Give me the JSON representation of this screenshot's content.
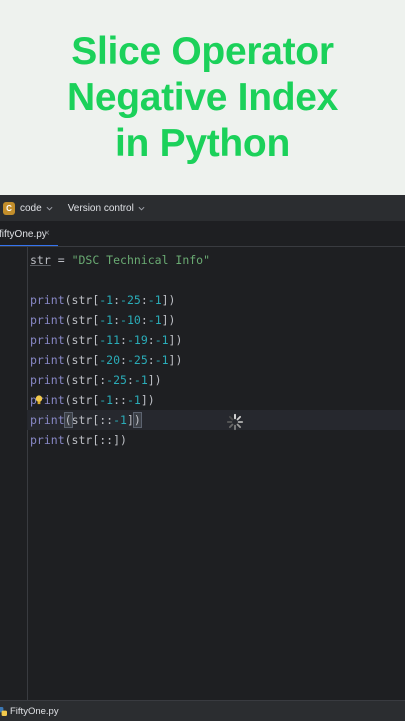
{
  "banner": {
    "line1": "Slice Operator",
    "line2": "Negative Index",
    "line3": "in Python"
  },
  "toolbar": {
    "project_badge": "C",
    "project_name": "code",
    "vcs_label": "Version control"
  },
  "tab": {
    "label": "fiftyOne.py",
    "close": "×"
  },
  "editor": {
    "lines": [
      [
        {
          "t": "var",
          "v": "str"
        },
        {
          "t": "pun",
          "v": " = "
        },
        {
          "t": "str",
          "v": "\"DSC Technical Info\""
        }
      ],
      [],
      [
        {
          "t": "fn",
          "v": "print"
        },
        {
          "t": "pun",
          "v": "(str["
        },
        {
          "t": "num",
          "v": "-1"
        },
        {
          "t": "pun",
          "v": ":"
        },
        {
          "t": "num",
          "v": "-25"
        },
        {
          "t": "pun",
          "v": ":"
        },
        {
          "t": "num",
          "v": "-1"
        },
        {
          "t": "pun",
          "v": "])"
        }
      ],
      [
        {
          "t": "fn",
          "v": "print"
        },
        {
          "t": "pun",
          "v": "(str["
        },
        {
          "t": "num",
          "v": "-1"
        },
        {
          "t": "pun",
          "v": ":"
        },
        {
          "t": "num",
          "v": "-10"
        },
        {
          "t": "pun",
          "v": ":"
        },
        {
          "t": "num",
          "v": "-1"
        },
        {
          "t": "pun",
          "v": "])"
        }
      ],
      [
        {
          "t": "fn",
          "v": "print"
        },
        {
          "t": "pun",
          "v": "(str["
        },
        {
          "t": "num",
          "v": "-11"
        },
        {
          "t": "pun",
          "v": ":"
        },
        {
          "t": "num",
          "v": "-19"
        },
        {
          "t": "pun",
          "v": ":"
        },
        {
          "t": "num",
          "v": "-1"
        },
        {
          "t": "pun",
          "v": "])"
        }
      ],
      [
        {
          "t": "fn",
          "v": "print"
        },
        {
          "t": "pun",
          "v": "(str["
        },
        {
          "t": "num",
          "v": "-20"
        },
        {
          "t": "pun",
          "v": ":"
        },
        {
          "t": "num",
          "v": "-25"
        },
        {
          "t": "pun",
          "v": ":"
        },
        {
          "t": "num",
          "v": "-1"
        },
        {
          "t": "pun",
          "v": "])"
        }
      ],
      [
        {
          "t": "fn",
          "v": "print"
        },
        {
          "t": "pun",
          "v": "(str[:"
        },
        {
          "t": "num",
          "v": "-25"
        },
        {
          "t": "pun",
          "v": ":"
        },
        {
          "t": "num",
          "v": "-1"
        },
        {
          "t": "pun",
          "v": "])"
        }
      ],
      [
        {
          "t": "fn",
          "v": "print"
        },
        {
          "t": "pun",
          "v": "(str["
        },
        {
          "t": "num",
          "v": "-1"
        },
        {
          "t": "pun",
          "v": "::"
        },
        {
          "t": "num",
          "v": "-1"
        },
        {
          "t": "pun",
          "v": "])"
        }
      ],
      [
        {
          "t": "fn",
          "v": "print"
        },
        {
          "t": "hl",
          "v": "("
        },
        {
          "t": "pun",
          "v": "str[::"
        },
        {
          "t": "num",
          "v": "-1"
        },
        {
          "t": "pun",
          "v": "]"
        },
        {
          "t": "hl",
          "v": ")"
        }
      ],
      [
        {
          "t": "fn",
          "v": "print"
        },
        {
          "t": "pun",
          "v": "(str[::])"
        }
      ]
    ],
    "current_line": 8,
    "bulb_line": 7
  },
  "statusbar": {
    "file": "FiftyOne.py"
  },
  "colors": {
    "banner_text": "#1bd15a",
    "accent": "#3574f0",
    "keyword_fn": "#8888c6",
    "string": "#6aab73",
    "number": "#2aacb8"
  },
  "icons": {
    "bulb": "lightbulb-icon",
    "spinner": "loading-spinner-icon",
    "python": "python-file-icon"
  }
}
